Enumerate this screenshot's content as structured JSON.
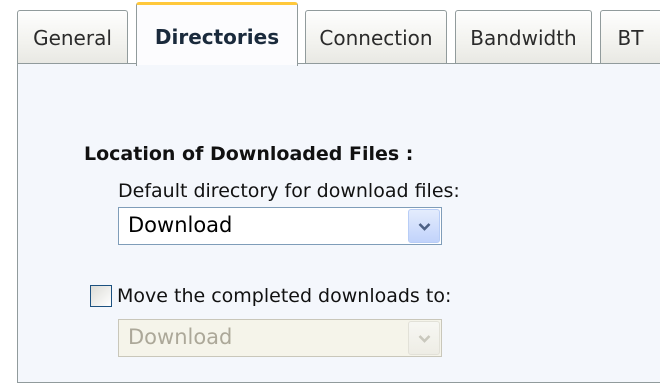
{
  "tabs": [
    {
      "label": "General",
      "active": false
    },
    {
      "label": "Directories",
      "active": true
    },
    {
      "label": "Connection",
      "active": false
    },
    {
      "label": "Bandwidth",
      "active": false
    },
    {
      "label": "BT",
      "active": false
    }
  ],
  "section": {
    "title": "Location of Downloaded Files :"
  },
  "default_directory": {
    "label": "Default directory for download files:",
    "value": "Download",
    "enabled": true
  },
  "move_completed": {
    "label": "Move the completed downloads to:",
    "checked": false,
    "value": "Download",
    "enabled": false
  },
  "colors": {
    "panel_background": "#f4f7fc",
    "active_tab_highlight": "#ffc83c",
    "border": "#919b9c",
    "disabled_text": "#aca899"
  },
  "icons": {
    "dropdown": "chevron-down-icon"
  }
}
